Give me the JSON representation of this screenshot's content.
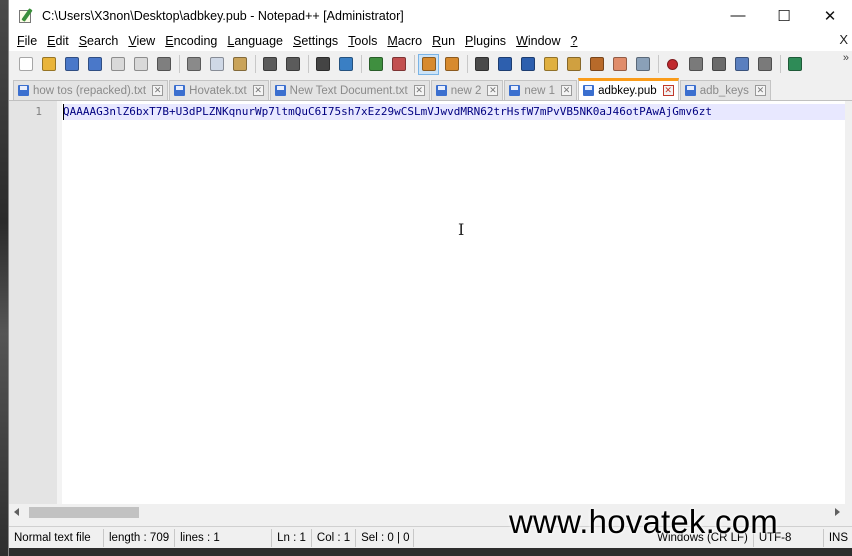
{
  "window": {
    "title": "C:\\Users\\X3non\\Desktop\\adbkey.pub - Notepad++ [Administrator]",
    "minimize_glyph": "—",
    "maximize_glyph": "☐",
    "close_glyph": "✕"
  },
  "menu": {
    "items": [
      {
        "ul": "F",
        "rest": "ile"
      },
      {
        "ul": "E",
        "rest": "dit"
      },
      {
        "ul": "S",
        "rest": "earch"
      },
      {
        "ul": "V",
        "rest": "iew"
      },
      {
        "ul": "E",
        "rest": "ncoding"
      },
      {
        "ul": "L",
        "rest": "anguage"
      },
      {
        "ul": "S",
        "rest": "ettings"
      },
      {
        "ul": "T",
        "rest": "ools"
      },
      {
        "ul": "M",
        "rest": "acro"
      },
      {
        "ul": "R",
        "rest": "un"
      },
      {
        "ul": "P",
        "rest": "lugins"
      },
      {
        "ul": "W",
        "rest": "indow"
      },
      {
        "ul": "?",
        "rest": ""
      }
    ],
    "close_label": "X"
  },
  "toolbar": {
    "more_label": "»",
    "icons": [
      "new-file-icon",
      "open-file-icon",
      "save-icon",
      "save-all-icon",
      "close-icon",
      "close-all-icon",
      "print-icon",
      "sep",
      "cut-icon",
      "copy-icon",
      "paste-icon",
      "sep",
      "undo-icon",
      "redo-icon",
      "sep",
      "find-icon",
      "replace-icon",
      "sep",
      "zoom-in-icon",
      "zoom-out-icon",
      "sep",
      "sync-vertical-icon",
      "sync-horizontal-icon",
      "sep",
      "word-wrap-icon",
      "show-all-chars-icon",
      "indent-guide-icon",
      "user-language-icon",
      "doc-map-icon",
      "function-list-icon",
      "folder-workspace-icon",
      "monitor-icon",
      "sep",
      "record-macro-icon",
      "stop-macro-icon",
      "play-macro-icon",
      "run-macro-multiple-icon",
      "save-macro-icon",
      "sep",
      "panel-icon"
    ],
    "active_index": 21
  },
  "tabs": [
    {
      "label": "how tos (repacked).txt",
      "active": false
    },
    {
      "label": "Hovatek.txt",
      "active": false
    },
    {
      "label": "New Text Document.txt",
      "active": false
    },
    {
      "label": "new 2",
      "active": false
    },
    {
      "label": "new 1",
      "active": false
    },
    {
      "label": "adbkey.pub",
      "active": true
    },
    {
      "label": "adb_keys",
      "active": false
    }
  ],
  "editor": {
    "line_number": "1",
    "line_text": "QAAAAG3nlZ6bxT7B+U3dPLZNKqnurWp7ltmQuC6I75sh7xEz29wCSLmVJwvdMRN62trHsfW7mPvVB5NK0aJ46otPAwAjGmv6zt"
  },
  "status": {
    "doc_type": "Normal text file",
    "length": "length : 709",
    "lines": "lines : 1",
    "ln": "Ln : 1",
    "col": "Col : 1",
    "sel": "Sel : 0 | 0",
    "eol": "Windows (CR LF)",
    "encoding": "UTF-8",
    "mode": "INS"
  },
  "watermark": "www.hovatek.com",
  "colors": {
    "active_tab_accent": "#fa9c1a",
    "line_highlight": "#e8e8ff",
    "text_color": "#000080"
  }
}
